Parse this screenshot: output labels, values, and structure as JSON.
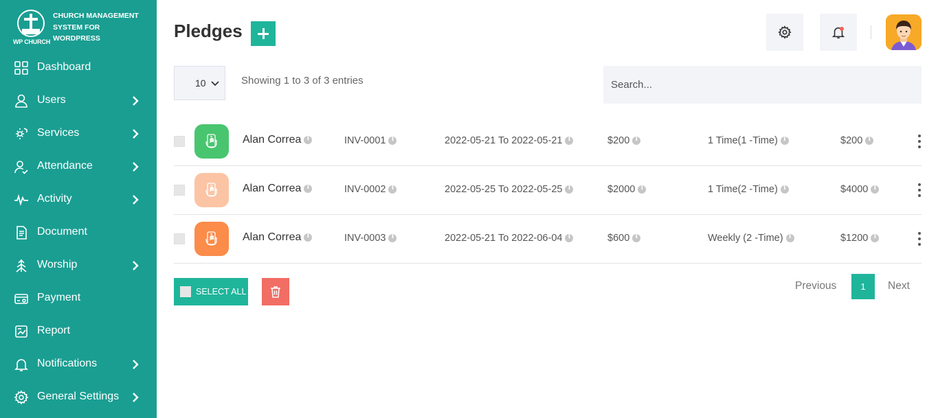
{
  "brand": {
    "logo_text": "WP CHURCH",
    "tagline_line1": "CHURCH MANAGEMENT",
    "tagline_line2": "SYSTEM FOR",
    "tagline_line3": "WORDPRESS"
  },
  "sidebar": {
    "items": [
      {
        "label": "Dashboard",
        "icon": "dashboard-grid-icon",
        "has_submenu": false
      },
      {
        "label": "Users",
        "icon": "user-icon",
        "has_submenu": true
      },
      {
        "label": "Services",
        "icon": "services-icon",
        "has_submenu": true
      },
      {
        "label": "Attendance",
        "icon": "user-check-icon",
        "has_submenu": true
      },
      {
        "label": "Activity",
        "icon": "activity-pulse-icon",
        "has_submenu": true
      },
      {
        "label": "Document",
        "icon": "document-icon",
        "has_submenu": false
      },
      {
        "label": "Worship",
        "icon": "worship-icon",
        "has_submenu": true
      },
      {
        "label": "Payment",
        "icon": "payment-icon",
        "has_submenu": false
      },
      {
        "label": "Report",
        "icon": "report-icon",
        "has_submenu": false
      },
      {
        "label": "Notifications",
        "icon": "bell-icon",
        "has_submenu": true
      },
      {
        "label": "General Settings",
        "icon": "gear-icon",
        "has_submenu": true
      }
    ]
  },
  "header": {
    "title": "Pledges"
  },
  "controls": {
    "page_length": "10",
    "info": "Showing 1 to 3 of 3 entries",
    "search_placeholder": "Search..."
  },
  "rows": [
    {
      "name": "Alan Correa",
      "invoice": "INV-0001",
      "dates": "2022-05-21 To 2022-05-21",
      "amount": "$200",
      "frequency": "1 Time(1 -Time)",
      "total": "$200",
      "icon_color": "#49c56f"
    },
    {
      "name": "Alan Correa",
      "invoice": "INV-0002",
      "dates": "2022-05-25 To 2022-05-25",
      "amount": "$2000",
      "frequency": "1 Time(2 -Time)",
      "total": "$4000",
      "icon_color": "#fbc4a4"
    },
    {
      "name": "Alan Correa",
      "invoice": "INV-0003",
      "dates": "2022-05-21 To 2022-06-04",
      "amount": "$600",
      "frequency": "Weekly (2 -Time)",
      "total": "$1200",
      "icon_color": "#fb8c4a"
    }
  ],
  "footer": {
    "select_all_label": "SELECT ALL",
    "prev_label": "Previous",
    "current_page": "1",
    "next_label": "Next"
  },
  "colors": {
    "sidebar": "#1a9e92",
    "accent": "#1fb59b",
    "danger": "#f26d63"
  }
}
